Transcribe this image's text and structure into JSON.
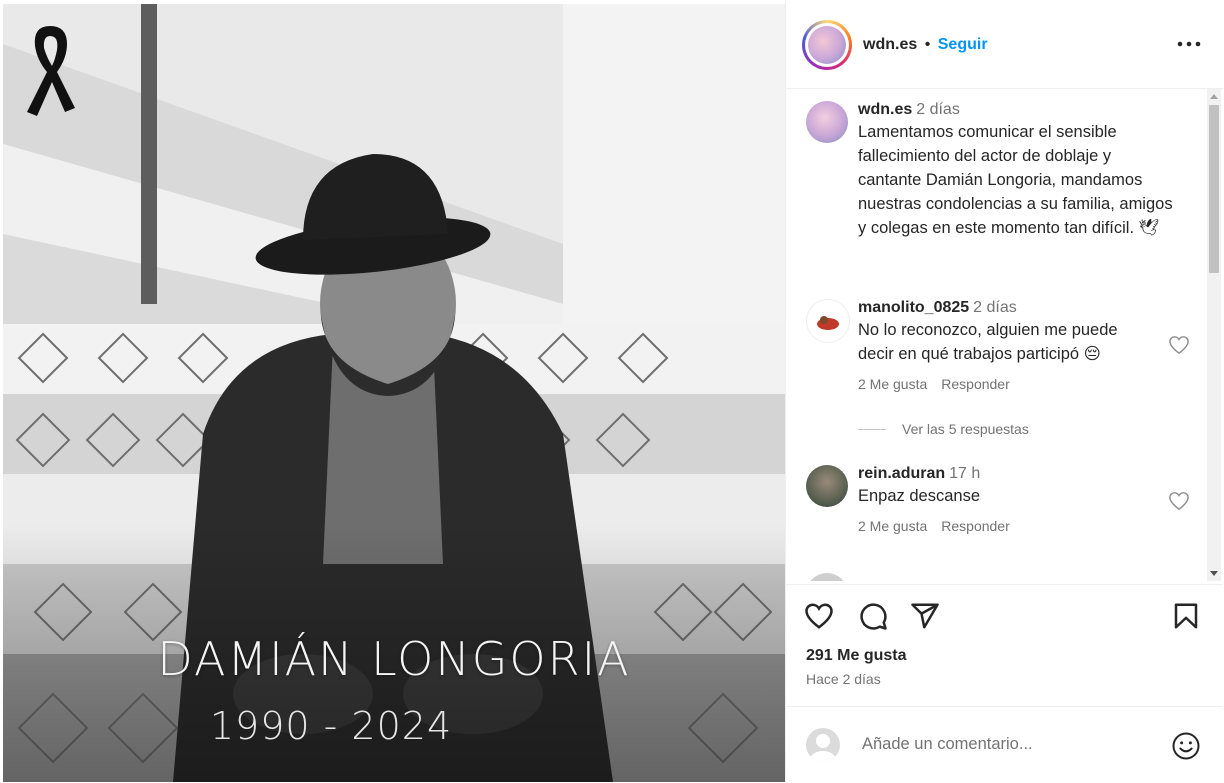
{
  "photo": {
    "name_overlay": "DAMIÁN LONGORIA",
    "years_overlay": "1990 - 2024",
    "icon": "mourning-ribbon-icon"
  },
  "header": {
    "username": "wdn.es",
    "separator": "•",
    "follow_label": "Seguir",
    "more_icon": "more-horizontal-icon"
  },
  "comments": [
    {
      "username": "wdn.es",
      "time": "2 días",
      "text": "Lamentamos comunicar el sensible fallecimiento del actor de doblaje y cantante Damián Longoria, mandamos nuestras condolencias a su familia, amigos y colegas en este momento tan difícil. 🕊"
    },
    {
      "username": "manolito_0825",
      "time": "2 días",
      "text": "No lo reconozco, alguien me puede decir en qué trabajos participó 😔",
      "likes": "2 Me gusta",
      "reply_label": "Responder"
    },
    {
      "username": "rein.aduran",
      "time": "17 h",
      "text": "Enpaz descanse",
      "likes": "2 Me gusta",
      "reply_label": "Responder"
    }
  ],
  "view_replies": "Ver las 5 respuestas",
  "actions": {
    "like_icon": "heart-icon",
    "comment_icon": "comment-icon",
    "share_icon": "send-icon",
    "save_icon": "bookmark-icon"
  },
  "likes_count": "291 Me gusta",
  "posted_ago": "Hace 2 días",
  "add_comment": {
    "placeholder": "Añade un comentario...",
    "emoji_icon": "emoji-icon"
  },
  "colors": {
    "accent": "#0095f6",
    "text": "#262626",
    "muted": "#737373"
  }
}
